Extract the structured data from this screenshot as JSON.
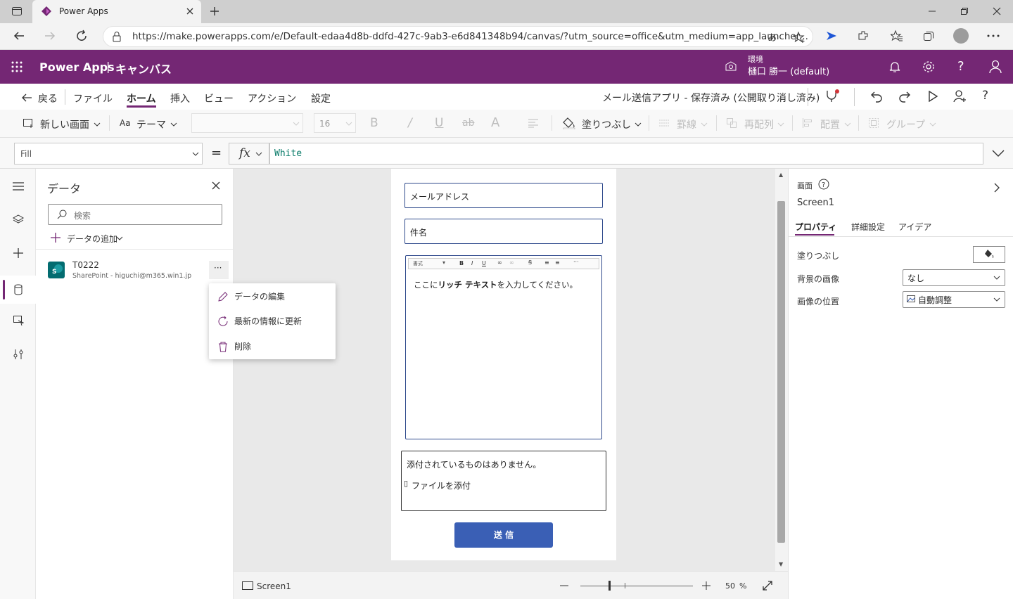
{
  "browser": {
    "tab_title": "Power Apps",
    "url": "https://make.powerapps.com/e/Default-edaa4d8b-ddfd-427c-9ab3-e6d841348b94/canvas/?utm_source=office&utm_medium=app_launcher...",
    "aa_label": "あ"
  },
  "header": {
    "app_name": "Power Apps",
    "separator": "|",
    "mode": "キャンバス",
    "env_label": "環境",
    "env_name": "樋口 勝一 (default)"
  },
  "cmdbar": {
    "back": "戻る",
    "menus": [
      "ファイル",
      "ホーム",
      "挿入",
      "ビュー",
      "アクション",
      "設定"
    ],
    "active_menu": "ホーム",
    "app_status": "メール送信アプリ - 保存済み (公開取り消し済み)"
  },
  "ribbon": {
    "new_screen": "新しい画面",
    "theme": "テーマ",
    "font_size": "16",
    "fill": "塗りつぶし",
    "border": "罫線",
    "reorder": "再配列",
    "align": "配置",
    "group": "グループ"
  },
  "formula": {
    "property": "Fill",
    "equals": "=",
    "fx": "fx",
    "value": "White"
  },
  "datapanel": {
    "title": "データ",
    "search_placeholder": "検索",
    "add_data": "データの追加",
    "source_name": "T0222",
    "source_desc": "SharePoint - higuchi@m365.win1.jp",
    "more": "···"
  },
  "context_menu": {
    "items": [
      "データの編集",
      "最新の情報に更新",
      "削除"
    ]
  },
  "screen_form": {
    "email_placeholder": "メールアドレス",
    "subject_placeholder": "件名",
    "rte_format": "書式",
    "rte_placeholder_pre": "ここに",
    "rte_placeholder_bold": "リッチ テキスト",
    "rte_placeholder_post": "を入力してください。",
    "attach_empty": "添付されているものはありません。",
    "attach_link": "ファイルを添付",
    "send_button": "送 信"
  },
  "bottombar": {
    "screen_name": "Screen1",
    "zoom": "50",
    "zoom_unit": "%",
    "zoom_level": 0.5
  },
  "rpanel": {
    "section": "画面",
    "screen_name": "Screen1",
    "tabs": [
      "プロパティ",
      "詳細設定",
      "アイデア"
    ],
    "fill_label": "塗りつぶし",
    "bg_image_label": "背景の画像",
    "bg_image_value": "なし",
    "image_pos_label": "画像の位置",
    "image_pos_value": "自動調整"
  },
  "colors": {
    "brand": "#742774",
    "send_button": "#3a5fb5",
    "input_border": "#2f4a8c"
  }
}
